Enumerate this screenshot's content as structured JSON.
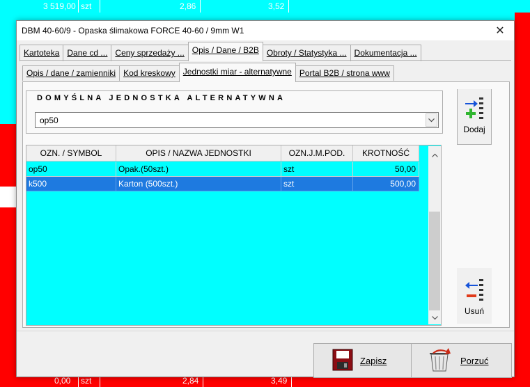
{
  "background": {
    "top_row": {
      "qty": "3 519,00",
      "unit": "szt",
      "price1": "2,86",
      "price2": "3,52"
    },
    "bottom_row": {
      "qty": "0,00",
      "unit": "szt",
      "price1": "2,84",
      "price2": "3,49"
    }
  },
  "dialog": {
    "title": "DBM 40-60/9 - Opaska ślimakowa FORCE  40-60 / 9mm W1",
    "close_glyph": "✕"
  },
  "tabs_main": [
    {
      "label": "Kartoteka"
    },
    {
      "label": "Dane cd ..."
    },
    {
      "label": "Ceny sprzedaży ..."
    },
    {
      "label": "Opis / Dane / B2B"
    },
    {
      "label": "Obroty / Statystyka ..."
    },
    {
      "label": "Dokumentacja ..."
    }
  ],
  "tabs_sub": [
    {
      "label": "Opis / dane / zamienniki"
    },
    {
      "label": "Kod kreskowy"
    },
    {
      "label": "Jednostki miar - alternatywne"
    },
    {
      "label": "Portal B2B / strona www"
    }
  ],
  "default_unit": {
    "title": "DOMYŚLNA JEDNOSTKA ALTERNATYWNA",
    "value": "op50"
  },
  "grid": {
    "columns": [
      "OZN. / SYMBOL",
      "OPIS / NAZWA JEDNOSTKI",
      "OZN.J.M.POD.",
      "KROTNOŚĆ"
    ],
    "rows": [
      {
        "symbol": "op50",
        "name": "Opak.(50szt.)",
        "base": "szt",
        "factor": "50,00",
        "selected": false
      },
      {
        "symbol": "k500",
        "name": "Karton (500szt.)",
        "base": "szt",
        "factor": "500,00",
        "selected": true
      }
    ]
  },
  "side": {
    "add_label": "Dodaj",
    "delete_label": "Usuń"
  },
  "footer": {
    "save_label": "Zapisz",
    "cancel_label": "Porzuć"
  },
  "colors": {
    "cyan": "#00ffff",
    "red": "#ff0000",
    "selection": "#1e7ae0"
  }
}
